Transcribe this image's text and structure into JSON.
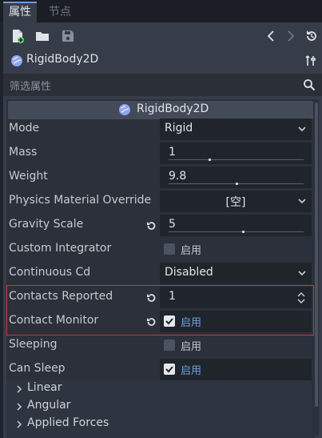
{
  "tabs": [
    {
      "label": "属性",
      "active": true
    },
    {
      "label": "节点",
      "active": false
    }
  ],
  "toolbar": {
    "icons": [
      "new-resource-icon",
      "open-folder-icon",
      "save-icon",
      "history-back-icon",
      "history-forward-icon",
      "object-history-icon"
    ]
  },
  "object": {
    "name": "RigidBody2D",
    "icon": "rigidbody2d-icon"
  },
  "filter": {
    "placeholder": "筛选属性"
  },
  "section": {
    "title": "RigidBody2D"
  },
  "properties": [
    {
      "label": "Mode",
      "type": "dropdown",
      "value": "Rigid"
    },
    {
      "label": "Mass",
      "type": "number-slider",
      "value": "1",
      "slider_fraction": 0.3
    },
    {
      "label": "Weight",
      "type": "number-slider",
      "value": "9.8",
      "slider_fraction": 0.5
    },
    {
      "label": "Physics Material Override",
      "type": "resource",
      "value": "[空]"
    },
    {
      "label": "Gravity Scale",
      "type": "number-slider",
      "value": "5",
      "revert": true,
      "slider_fraction": 0.55
    },
    {
      "label": "Custom Integrator",
      "type": "checkbox",
      "checked": false,
      "check_label": "启用"
    },
    {
      "label": "Continuous Cd",
      "type": "dropdown",
      "value": "Disabled"
    },
    {
      "label": "Contacts Reported",
      "type": "spinbox",
      "value": "1",
      "revert": true
    },
    {
      "label": "Contact Monitor",
      "type": "checkbox",
      "checked": true,
      "check_label": "启用",
      "revert": true
    },
    {
      "label": "Sleeping",
      "type": "checkbox",
      "checked": false,
      "check_label": "启用"
    },
    {
      "label": "Can Sleep",
      "type": "checkbox",
      "checked": true,
      "check_label": "启用"
    }
  ],
  "groups": [
    {
      "label": "Linear"
    },
    {
      "label": "Angular"
    },
    {
      "label": "Applied Forces"
    }
  ],
  "colors": {
    "accent": "#6ea3e6",
    "highlight_border": "#d0323c",
    "panel_bg": "#363c48"
  }
}
